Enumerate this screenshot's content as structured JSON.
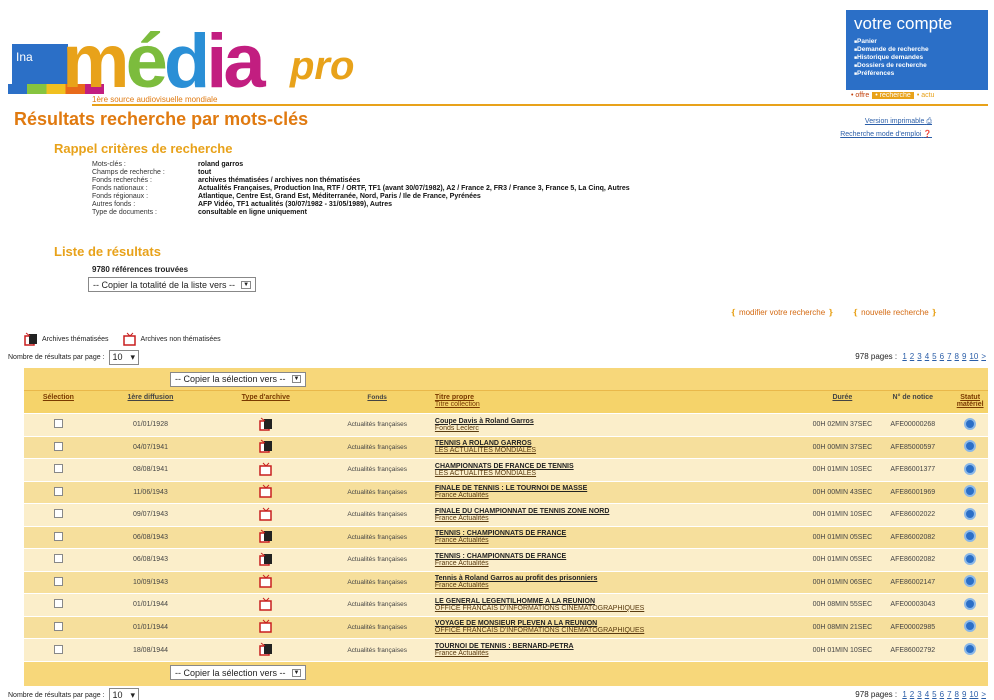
{
  "brand": {
    "ina": "Ina",
    "media": [
      "m",
      "é",
      "d",
      "i",
      "a"
    ],
    "pro": "pro",
    "tagline": "1ère source audiovisuelle mondiale"
  },
  "account": {
    "title": "votre compte",
    "items": [
      "Panier",
      "Demande de recherche",
      "Historique demandes",
      "Dossiers de recherche",
      "Préférences"
    ]
  },
  "topnav": {
    "offre": "• offre",
    "recherche": "• recherche",
    "actu": "• actu"
  },
  "page_title": "Résultats recherche par mots-clés",
  "links": {
    "print": "Version imprimable",
    "help": "Recherche mode d'emploi"
  },
  "criteria": {
    "heading": "Rappel critères de recherche",
    "rows": [
      {
        "k": "Mots-clés :",
        "v": "roland garros"
      },
      {
        "k": "Champs de recherche :",
        "v": "tout"
      },
      {
        "k": "Fonds recherchés :",
        "v": "archives thématisées / archives non thématisées"
      },
      {
        "k": "Fonds nationaux :",
        "v": "Actualités Françaises, Production Ina, RTF / ORTF, TF1 (avant 30/07/1982), A2 / France 2, FR3 / France 3, France 5, La Cinq, Autres"
      },
      {
        "k": "Fonds régionaux :",
        "v": "Atlantique, Centre Est, Grand Est, Méditerranée, Nord, Paris / Ile de France, Pyrénées"
      },
      {
        "k": "Autres fonds :",
        "v": "AFP Vidéo, TF1 actualités (30/07/1982 - 31/05/1989), Autres"
      },
      {
        "k": "Type de documents :",
        "v": "consultable en ligne uniquement"
      }
    ]
  },
  "results": {
    "heading": "Liste de résultats",
    "count": "9780 références trouvées",
    "copy_all": "-- Copier la totalité de la liste vers --",
    "copy_sel": "-- Copier la sélection vers --",
    "modify": "modifier votre recherche",
    "new": "nouvelle recherche",
    "legend_them": "Archives thématisées",
    "legend_non": "Archives non thématisées",
    "perpage_label": "Nombre de résultats par page :",
    "perpage_value": "10",
    "pages_label": "978 pages :",
    "page_numbers": [
      "1",
      "2",
      "3",
      "4",
      "5",
      "6",
      "7",
      "8",
      "9",
      "10",
      ">"
    ]
  },
  "table": {
    "headers": {
      "sel": "Sélection",
      "date": "1ère diffusion",
      "type": "Type d'archive",
      "fonds": "Fonds",
      "titre": "Titre propre",
      "collection": "Titre collection",
      "duree": "Durée",
      "notice": "N° de notice",
      "statut": "Statut matériel"
    },
    "rows": [
      {
        "date": "01/01/1928",
        "type": "them",
        "fonds": "Actualités françaises",
        "titre": "Coupe Davis à Roland Garros",
        "coll": "Fonds Leclerc",
        "duree": "00H 02MIN 37SEC",
        "notice": "AFE00000268"
      },
      {
        "date": "04/07/1941",
        "type": "them",
        "fonds": "Actualités françaises",
        "titre": "TENNIS A ROLAND GARROS",
        "coll": "LES ACTUALITES MONDIALES",
        "duree": "00H 00MIN 37SEC",
        "notice": "AFE85000597"
      },
      {
        "date": "08/08/1941",
        "type": "non",
        "fonds": "Actualités françaises",
        "titre": "CHAMPIONNATS DE FRANCE DE TENNIS",
        "coll": "LES ACTUALITES MONDIALES",
        "duree": "00H 01MIN 10SEC",
        "notice": "AFE86001377"
      },
      {
        "date": "11/06/1943",
        "type": "non",
        "fonds": "Actualités françaises",
        "titre": "FINALE DE TENNIS : LE TOURNOI DE MASSE",
        "coll": "France Actualités",
        "duree": "00H 00MIN 43SEC",
        "notice": "AFE86001969"
      },
      {
        "date": "09/07/1943",
        "type": "non",
        "fonds": "Actualités françaises",
        "titre": "FINALE DU CHAMPIONNAT DE TENNIS ZONE NORD",
        "coll": "France Actualités",
        "duree": "00H 01MIN 10SEC",
        "notice": "AFE86002022"
      },
      {
        "date": "06/08/1943",
        "type": "them",
        "fonds": "Actualités françaises",
        "titre": "TENNIS : CHAMPIONNATS DE FRANCE",
        "coll": "France Actualités",
        "duree": "00H 01MIN 05SEC",
        "notice": "AFE86002082"
      },
      {
        "date": "06/08/1943",
        "type": "them",
        "fonds": "Actualités françaises",
        "titre": "TENNIS : CHAMPIONNATS DE FRANCE",
        "coll": "France Actualités",
        "duree": "00H 01MIN 05SEC",
        "notice": "AFE86002082"
      },
      {
        "date": "10/09/1943",
        "type": "non",
        "fonds": "Actualités françaises",
        "titre": "Tennis à Roland Garros au profit des prisonniers",
        "coll": "France Actualités",
        "duree": "00H 01MIN 06SEC",
        "notice": "AFE86002147"
      },
      {
        "date": "01/01/1944",
        "type": "non",
        "fonds": "Actualités françaises",
        "titre": "LE GENERAL LEGENTILHOMME A LA REUNION",
        "coll": "OFFICE FRANCAIS D'INFORMATIONS CINEMATOGRAPHIQUES",
        "duree": "00H 08MIN 55SEC",
        "notice": "AFE00003043"
      },
      {
        "date": "01/01/1944",
        "type": "non",
        "fonds": "Actualités françaises",
        "titre": "VOYAGE DE MONSIEUR PLEVEN A LA REUNION",
        "coll": "OFFICE FRANCAIS D'INFORMATIONS CINEMATOGRAPHIQUES",
        "duree": "00H 08MIN 21SEC",
        "notice": "AFE00002985"
      },
      {
        "date": "18/08/1944",
        "type": "them",
        "fonds": "Actualités françaises",
        "titre": "TOURNOI DE TENNIS : BERNARD-PETRA",
        "coll": "France Actualités",
        "duree": "00H 01MIN 10SEC",
        "notice": "AFE86002792"
      }
    ]
  },
  "colors": {
    "orange": "#e07a10",
    "blue": "#2b6fc7",
    "table_header": "#f5d36a"
  }
}
